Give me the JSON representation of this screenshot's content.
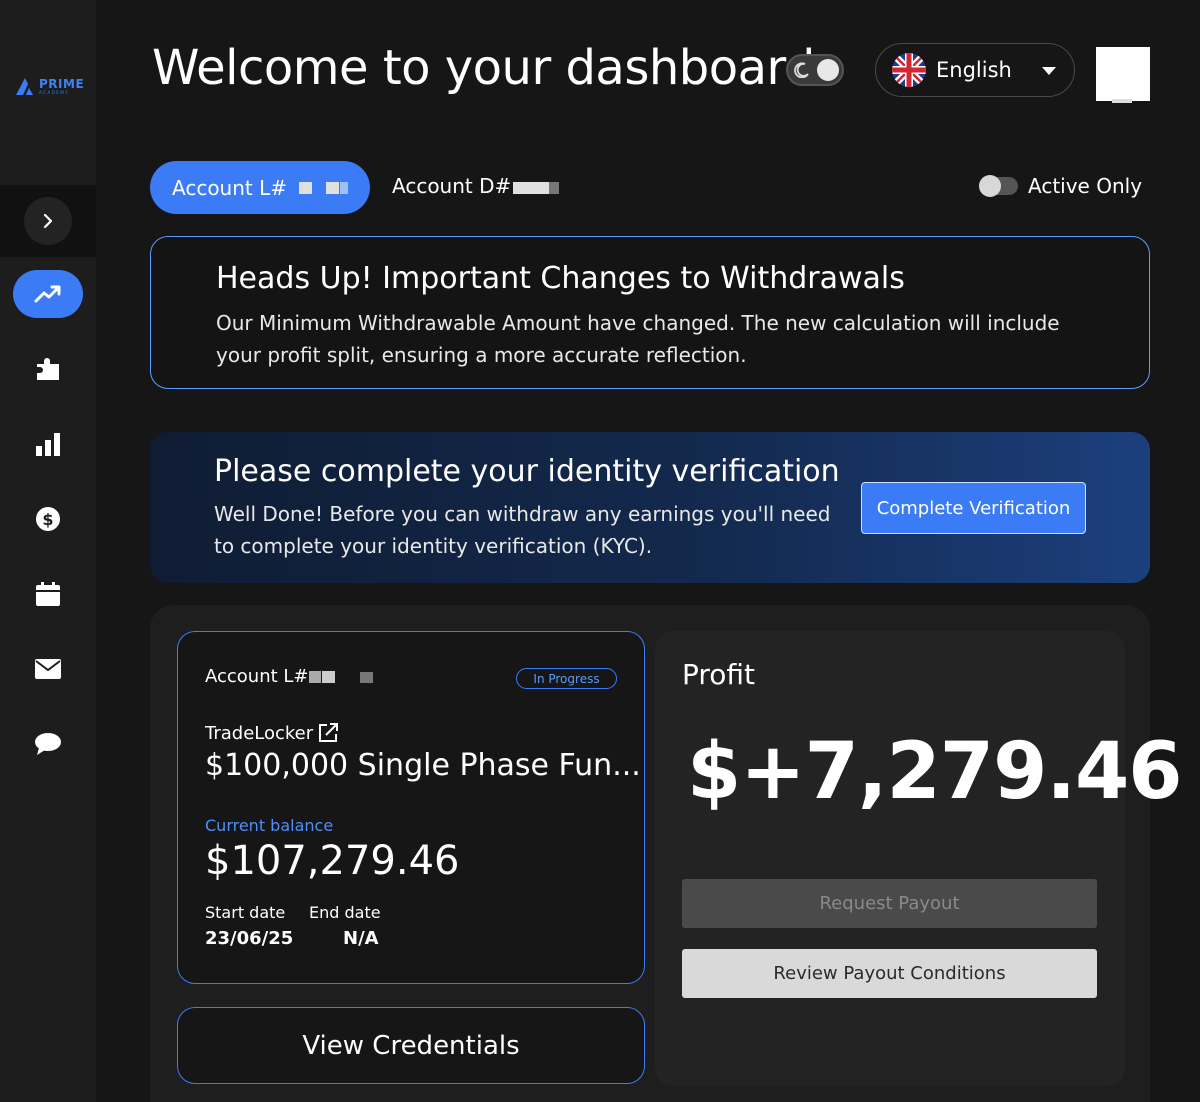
{
  "brand": {
    "name": "PRIME",
    "tagline": "ACADEMY",
    "accent": "#3b7cf6"
  },
  "header": {
    "title": "Welcome to your dashboard",
    "language": "English"
  },
  "sidebar": {
    "items": [
      {
        "icon": "trend-up-icon",
        "active": true
      },
      {
        "icon": "puzzle-icon",
        "active": false
      },
      {
        "icon": "bar-chart-icon",
        "active": false
      },
      {
        "icon": "dollar-icon",
        "active": false
      },
      {
        "icon": "calendar-icon",
        "active": false
      },
      {
        "icon": "mail-icon",
        "active": false
      },
      {
        "icon": "chat-icon",
        "active": false
      }
    ]
  },
  "tabs": [
    {
      "label": "Account L#",
      "active": true
    },
    {
      "label": "Account D#",
      "active": false
    }
  ],
  "filter": {
    "label": "Active Only"
  },
  "notice": {
    "title": "Heads Up! Important Changes to Withdrawals",
    "body": "Our Minimum Withdrawable Amount have changed. The new calculation will include your profit split, ensuring a more accurate reflection."
  },
  "kyc": {
    "title": "Please complete your identity verification",
    "body": "Well Done! Before you can withdraw any earnings you'll need to complete your identity verification (KYC).",
    "button": "Complete Verification"
  },
  "account_card": {
    "id_label": "Account L#",
    "status": "In Progress",
    "platform": "TradeLocker",
    "plan": "$100,000 Single Phase Fun...",
    "balance_label": "Current balance",
    "balance": "$107,279.46",
    "start_label": "Start date",
    "start_value": "23/06/25",
    "end_label": "End date",
    "end_value": "N/A"
  },
  "credentials_button": "View Credentials",
  "profit": {
    "title": "Profit",
    "value": "$+7,279.46",
    "request_button": "Request Payout",
    "conditions_button": "Review Payout Conditions"
  }
}
